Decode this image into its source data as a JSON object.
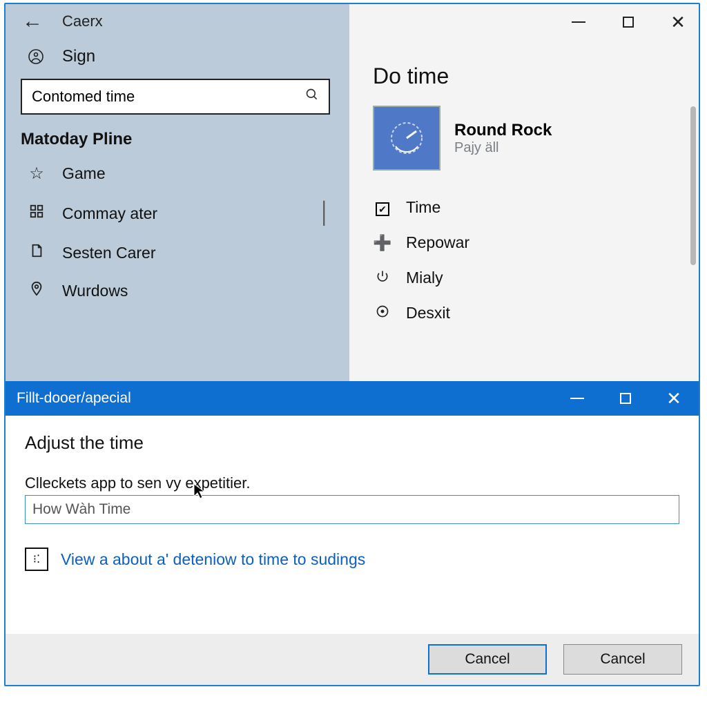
{
  "header": {
    "app_title": "Caerx"
  },
  "sidebar": {
    "sign_label": "Sign",
    "search_value": "Contomed time",
    "section_label": "Matoday Pline",
    "items": [
      {
        "label": "Game"
      },
      {
        "label": "Commay ater"
      },
      {
        "label": "Sesten Carer"
      },
      {
        "label": "Wurdows"
      }
    ]
  },
  "content": {
    "title": "Do time",
    "app_name": "Round Rock",
    "app_sub": "Pajy äll",
    "options": [
      {
        "label": "Time"
      },
      {
        "label": "Repowar"
      },
      {
        "label": "Mialy"
      },
      {
        "label": "Desxit"
      }
    ]
  },
  "dialog": {
    "title": "Fillt-dooer/apecial",
    "heading": "Adjust the time",
    "desc": "Clleckets app to sen vy expetitier.",
    "input_value": "How Wàh Time",
    "link_text": "View a about a' deteniow  to time to sudings",
    "btn_primary": "Cancel",
    "btn_secondary": "Cancel"
  }
}
